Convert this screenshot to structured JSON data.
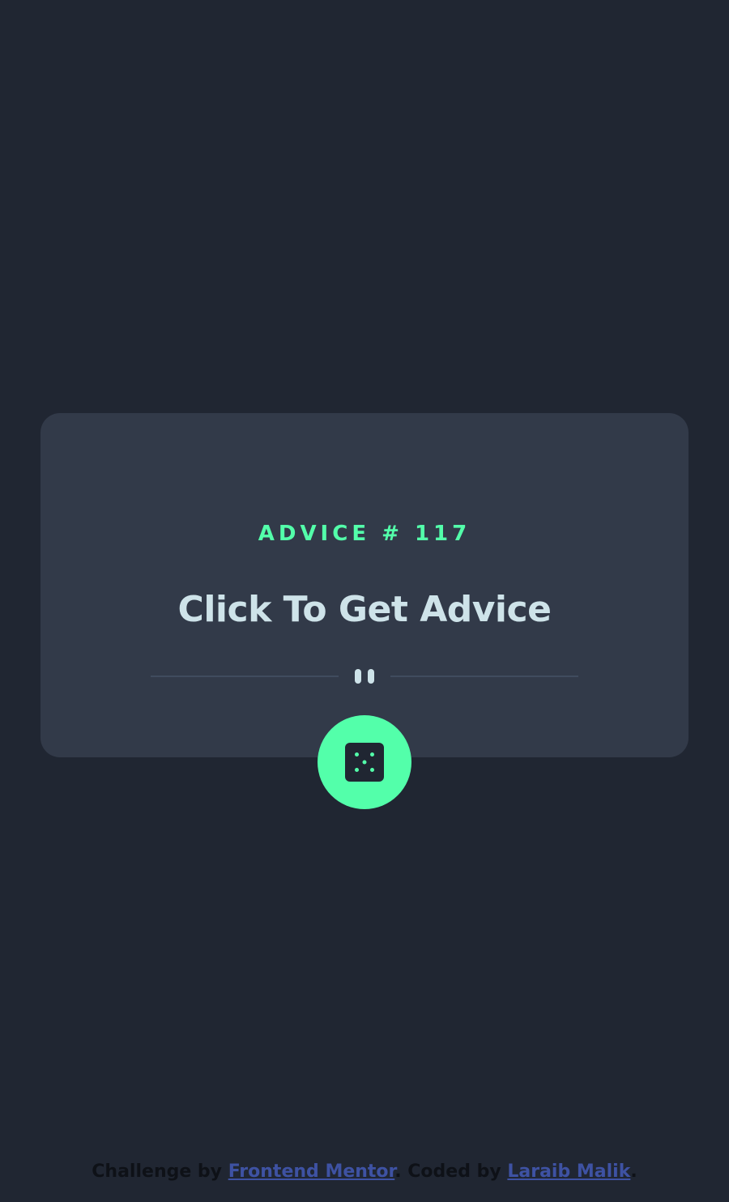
{
  "card": {
    "advice_id": "ADVICE # 117",
    "advice_text": "Click To Get Advice"
  },
  "icons": {
    "divider": "pause-divider-icon",
    "dice": "dice-icon"
  },
  "attribution": {
    "prefix": "Challenge by ",
    "challenge_link": "Frontend Mentor",
    "middle": ". Coded by ",
    "author_link": "Laraib Malik",
    "suffix": "."
  },
  "colors": {
    "background": "#202632",
    "card": "#323a49",
    "accent": "#53ffaa",
    "heading": "#cee3e9",
    "link": "#3e52a3"
  }
}
